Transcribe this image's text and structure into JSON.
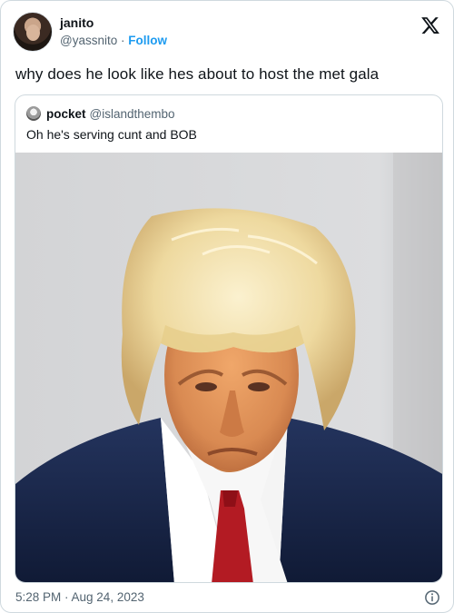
{
  "tweet": {
    "author": {
      "display_name": "janito",
      "handle": "@yassnito",
      "separator": " · ",
      "follow_label": "Follow"
    },
    "text": "why does he look like hes about to host the met gala",
    "timestamp": "5:28 PM · Aug 24, 2023"
  },
  "quoted_tweet": {
    "author": {
      "display_name": "pocket",
      "handle": "@islandthembo"
    },
    "text": "Oh he's serving cunt and BOB"
  },
  "icons": {
    "logo": "x-logo-icon",
    "info": "info-icon"
  },
  "colors": {
    "accent": "#1d9bf0",
    "text": "#0f1419",
    "muted": "#536471",
    "border": "#cfd9de"
  }
}
